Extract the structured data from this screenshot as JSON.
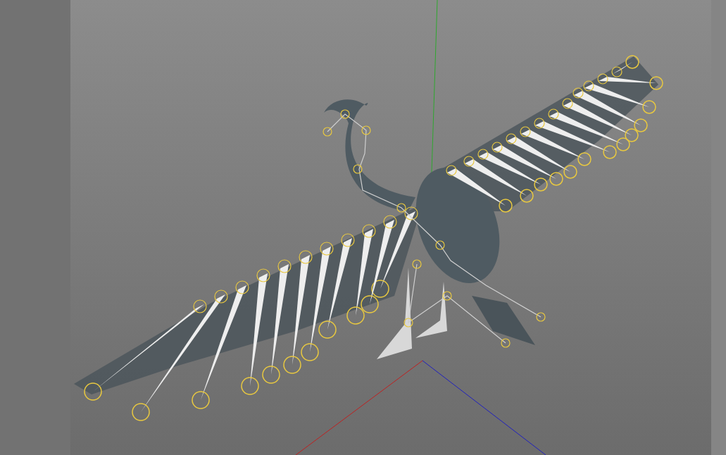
{
  "viewport": {
    "axes_visible": true
  }
}
